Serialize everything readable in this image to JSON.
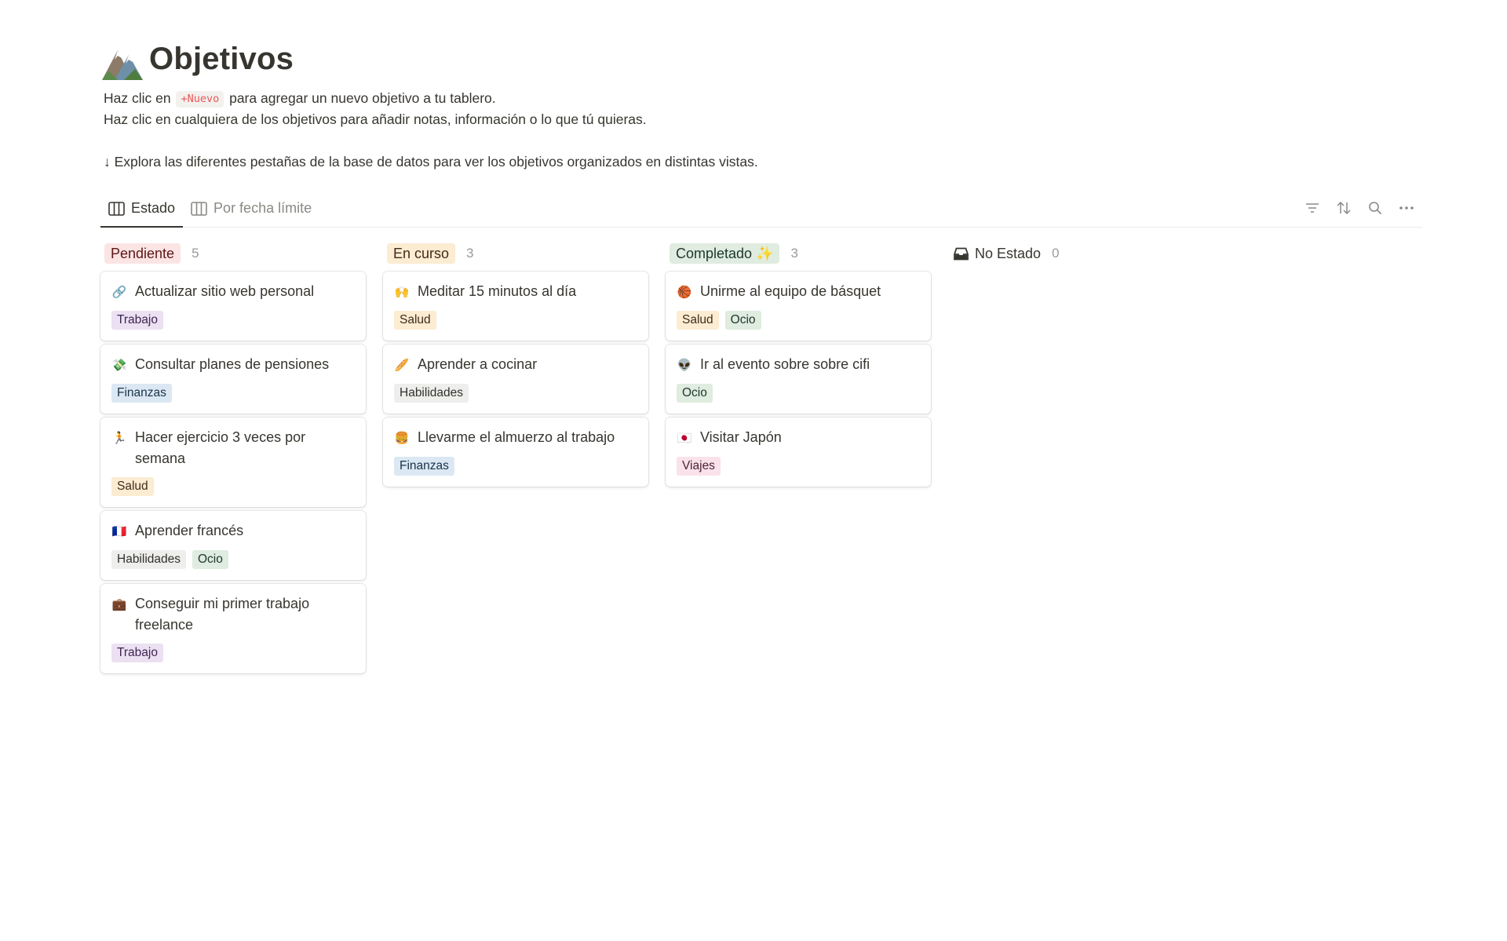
{
  "page": {
    "title": "Objetivos",
    "desc_line1_before": "Haz clic en ",
    "desc_chip": "+Nuevo",
    "desc_line1_after": " para agregar un nuevo objetivo a tu tablero.",
    "desc_line2": "Haz clic en cualquiera de los objetivos para añadir notas, información o lo que tú quieras.",
    "desc_line3": "↓ Explora las diferentes pestañas de la base de datos para ver los objetivos organizados en distintas vistas."
  },
  "tabs": [
    {
      "label": "Estado",
      "active": true
    },
    {
      "label": "Por fecha límite",
      "active": false
    }
  ],
  "tag_colors": {
    "Trabajo": {
      "bg": "#ebe1f2",
      "fg": "#412454"
    },
    "Finanzas": {
      "bg": "#dbe8f3",
      "fg": "#183347"
    },
    "Salud": {
      "bg": "#fbecd2",
      "fg": "#402c1b"
    },
    "Habilidades": {
      "bg": "#eeeeec",
      "fg": "#32302c"
    },
    "Ocio": {
      "bg": "#dfecdf",
      "fg": "#1c3829"
    },
    "Viajes": {
      "bg": "#f9e2ea",
      "fg": "#4c2337"
    }
  },
  "columns": [
    {
      "label": "Pendiente",
      "count": "5",
      "bg": "#fbe4e4",
      "fg": "#5d1715",
      "cards": [
        {
          "emoji": "🔗",
          "title": "Actualizar sitio web personal",
          "tags": [
            "Trabajo"
          ]
        },
        {
          "emoji": "💸",
          "title": "Consultar planes de pensiones",
          "tags": [
            "Finanzas"
          ]
        },
        {
          "emoji": "🏃",
          "title": "Hacer ejercicio 3 veces por semana",
          "tags": [
            "Salud"
          ]
        },
        {
          "emoji": "🇫🇷",
          "title": "Aprender francés",
          "tags": [
            "Habilidades",
            "Ocio"
          ]
        },
        {
          "emoji": "💼",
          "title": "Conseguir mi primer trabajo freelance",
          "tags": [
            "Trabajo"
          ]
        }
      ]
    },
    {
      "label": "En curso",
      "count": "3",
      "bg": "#fbecd2",
      "fg": "#402c1b",
      "cards": [
        {
          "emoji": "🙌",
          "title": "Meditar 15 minutos al día",
          "tags": [
            "Salud"
          ]
        },
        {
          "emoji": "🥖",
          "title": "Aprender a cocinar",
          "tags": [
            "Habilidades"
          ]
        },
        {
          "emoji": "🍔",
          "title": "Llevarme el almuerzo al trabajo",
          "tags": [
            "Finanzas"
          ]
        }
      ]
    },
    {
      "label": "Completado ✨",
      "count": "3",
      "bg": "#dfecdf",
      "fg": "#1c3829",
      "cards": [
        {
          "emoji": "🏀",
          "title": "Unirme al equipo de básquet",
          "tags": [
            "Salud",
            "Ocio"
          ]
        },
        {
          "emoji": "👽",
          "title": "Ir al evento sobre sobre cifi",
          "tags": [
            "Ocio"
          ]
        },
        {
          "emoji": "🇯🇵",
          "title": "Visitar Japón",
          "tags": [
            "Viajes"
          ]
        }
      ]
    }
  ],
  "no_state": {
    "label": "No Estado",
    "count": "0"
  },
  "icons": {
    "title": "mountain-icon",
    "tab": "board-view-icon",
    "filter": "filter-icon",
    "sort": "sort-icon",
    "search": "search-icon",
    "more": "more-icon",
    "no_state": "inbox-icon"
  }
}
